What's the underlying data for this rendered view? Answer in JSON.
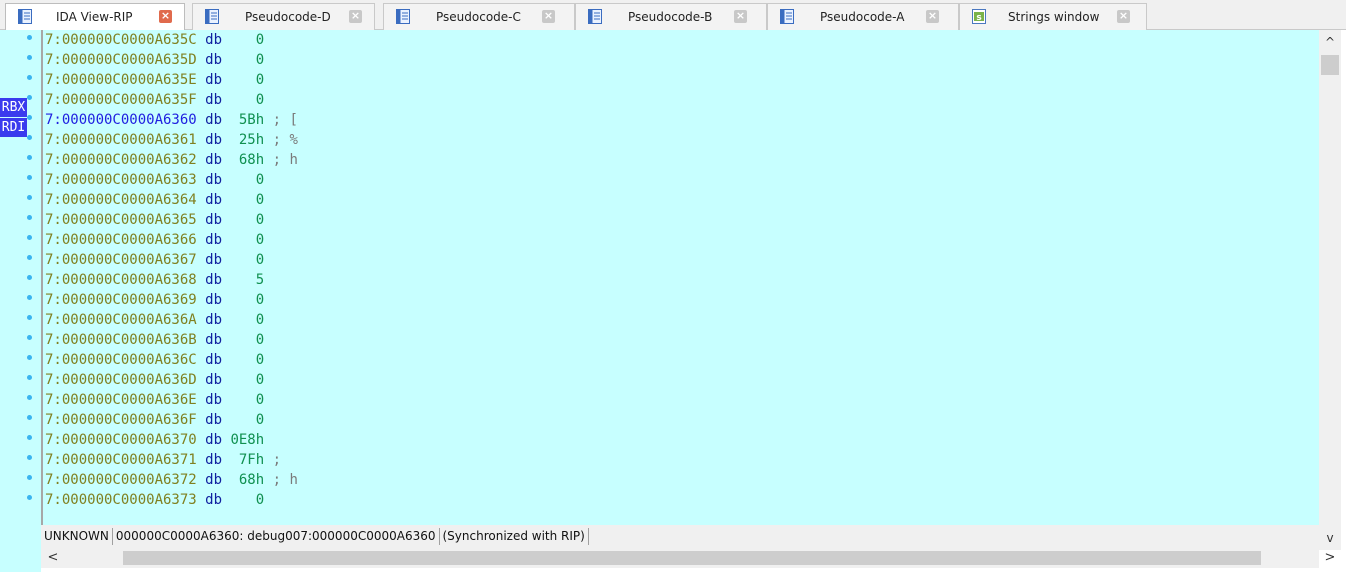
{
  "tabs": [
    {
      "label": "IDA View-RIP",
      "active": true,
      "icon": "listing-icon"
    },
    {
      "label": "Pseudocode-D",
      "active": false,
      "icon": "listing-icon"
    },
    {
      "label": "Pseudocode-C",
      "active": false,
      "icon": "listing-icon"
    },
    {
      "label": "Pseudocode-B",
      "active": false,
      "icon": "listing-icon"
    },
    {
      "label": "Pseudocode-A",
      "active": false,
      "icon": "listing-icon"
    },
    {
      "label": "Strings window",
      "active": false,
      "icon": "strings-icon"
    }
  ],
  "close_glyph": "×",
  "registers": [
    {
      "name": "RBX",
      "row": 4
    },
    {
      "name": "RDI",
      "row": 5
    }
  ],
  "listing": [
    {
      "addr": "7:000000C0000A635C",
      "op": "db",
      "val": "   0",
      "comment": ""
    },
    {
      "addr": "7:000000C0000A635D",
      "op": "db",
      "val": "   0",
      "comment": ""
    },
    {
      "addr": "7:000000C0000A635E",
      "op": "db",
      "val": "   0",
      "comment": ""
    },
    {
      "addr": "7:000000C0000A635F",
      "op": "db",
      "val": "   0",
      "comment": ""
    },
    {
      "addr": "7:000000C0000A6360",
      "op": "db",
      "val": " 5Bh",
      "comment": " ; [",
      "current": true
    },
    {
      "addr": "7:000000C0000A6361",
      "op": "db",
      "val": " 25h",
      "comment": " ; %"
    },
    {
      "addr": "7:000000C0000A6362",
      "op": "db",
      "val": " 68h",
      "comment": " ; h"
    },
    {
      "addr": "7:000000C0000A6363",
      "op": "db",
      "val": "   0",
      "comment": ""
    },
    {
      "addr": "7:000000C0000A6364",
      "op": "db",
      "val": "   0",
      "comment": ""
    },
    {
      "addr": "7:000000C0000A6365",
      "op": "db",
      "val": "   0",
      "comment": ""
    },
    {
      "addr": "7:000000C0000A6366",
      "op": "db",
      "val": "   0",
      "comment": ""
    },
    {
      "addr": "7:000000C0000A6367",
      "op": "db",
      "val": "   0",
      "comment": ""
    },
    {
      "addr": "7:000000C0000A6368",
      "op": "db",
      "val": "   5",
      "comment": ""
    },
    {
      "addr": "7:000000C0000A6369",
      "op": "db",
      "val": "   0",
      "comment": ""
    },
    {
      "addr": "7:000000C0000A636A",
      "op": "db",
      "val": "   0",
      "comment": ""
    },
    {
      "addr": "7:000000C0000A636B",
      "op": "db",
      "val": "   0",
      "comment": ""
    },
    {
      "addr": "7:000000C0000A636C",
      "op": "db",
      "val": "   0",
      "comment": ""
    },
    {
      "addr": "7:000000C0000A636D",
      "op": "db",
      "val": "   0",
      "comment": ""
    },
    {
      "addr": "7:000000C0000A636E",
      "op": "db",
      "val": "   0",
      "comment": ""
    },
    {
      "addr": "7:000000C0000A636F",
      "op": "db",
      "val": "   0",
      "comment": ""
    },
    {
      "addr": "7:000000C0000A6370",
      "op": "db",
      "val": "0E8h",
      "comment": ""
    },
    {
      "addr": "7:000000C0000A6371",
      "op": "db",
      "val": " 7Fh",
      "comment": " ;"
    },
    {
      "addr": "7:000000C0000A6372",
      "op": "db",
      "val": " 68h",
      "comment": " ; h"
    },
    {
      "addr": "7:000000C0000A6373",
      "op": "db",
      "val": "   0",
      "comment": ""
    }
  ],
  "status": {
    "segment_type": "UNKNOWN",
    "location": "000000C0000A6360: debug007:000000C0000A6360",
    "sync": "(Synchronized with RIP)"
  },
  "scroll": {
    "up_glyph": "^",
    "down_glyph": "v",
    "left_glyph": "<",
    "right_glyph": ">"
  }
}
